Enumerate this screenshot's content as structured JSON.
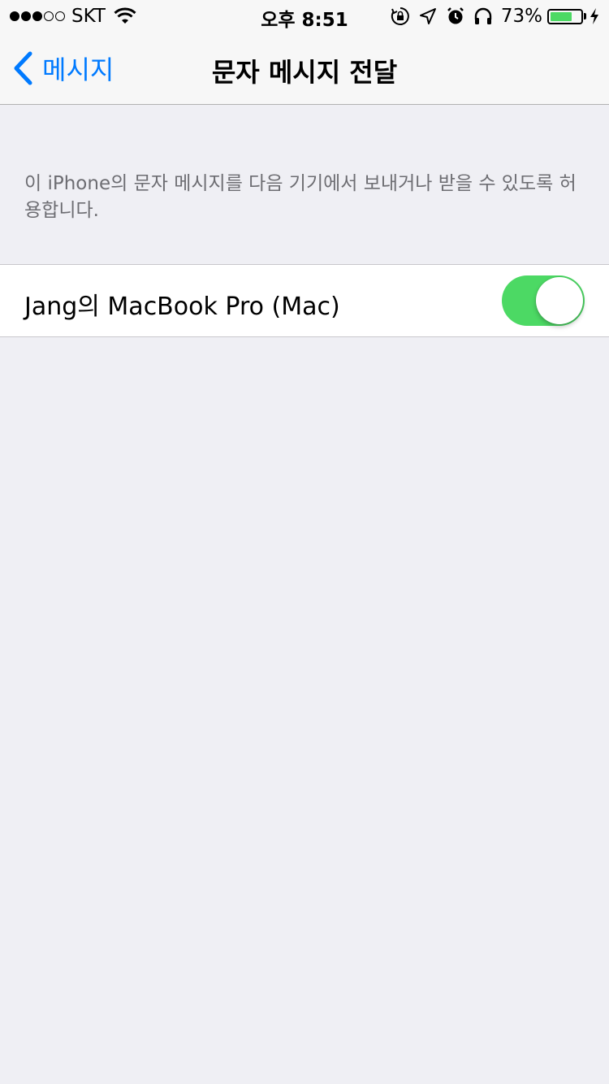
{
  "status_bar": {
    "signal_icon": "signal-dots-3-of-5",
    "carrier": "SKT",
    "wifi_icon": "wifi-icon",
    "time": "오후 8:51",
    "icons": [
      "rotation-lock-icon",
      "location-arrow-icon",
      "alarm-clock-icon",
      "headphones-icon"
    ],
    "battery_percent": "73%",
    "battery_level": 0.73,
    "battery_color": "#4cd964",
    "charging_icon": "charging-bolt-icon"
  },
  "nav": {
    "back_icon": "chevron-left-icon",
    "back_label": "메시지",
    "title": "문자 메시지 전달",
    "accent_color": "#007aff"
  },
  "section": {
    "footer": "이 iPhone의 문자 메시지를 다음 기기에서 보내거나 받을 수 있도록 허용합니다."
  },
  "devices": [
    {
      "label": "Jang의 MacBook Pro (Mac)",
      "enabled": true,
      "switch_color": "#4cd964"
    }
  ]
}
